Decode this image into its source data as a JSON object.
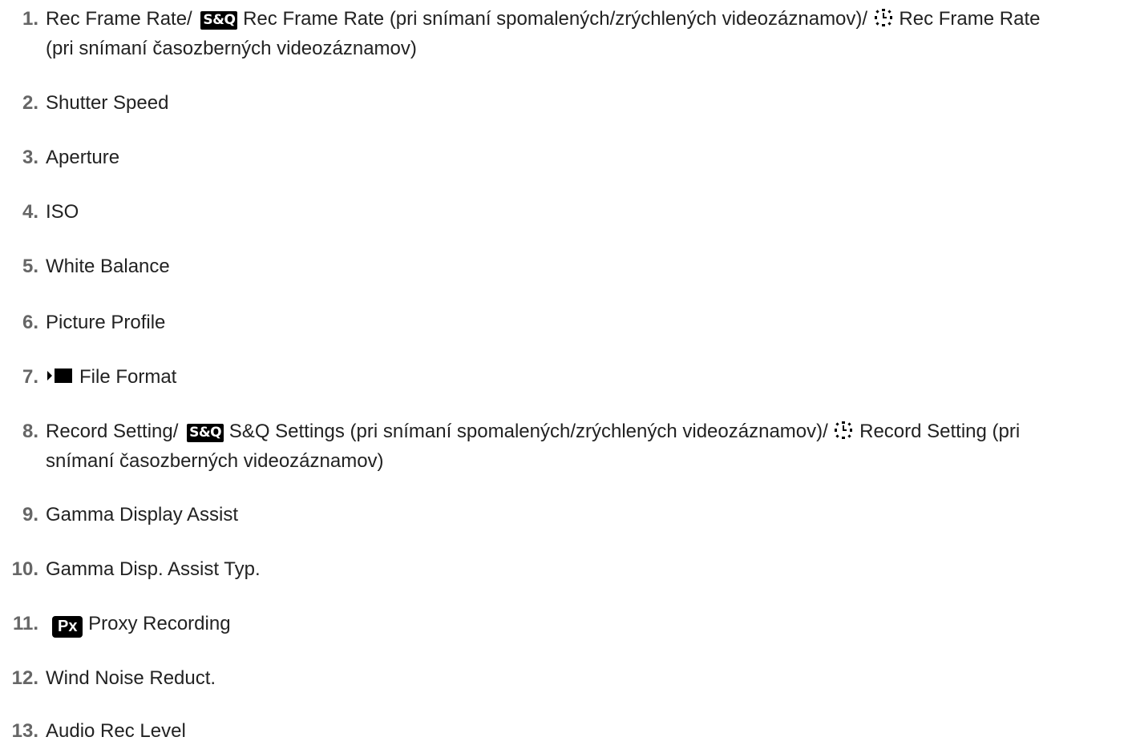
{
  "items": [
    {
      "num": "1.",
      "t1": "Rec Frame Rate/ ",
      "icon1": "S&Q",
      "t2": "Rec Frame Rate (pri snímaní spomalených/zrýchlených videozáznamov)/ ",
      "icon2": "time-lapse-icon",
      "t3": "Rec Frame Rate",
      "t4": "(pri snímaní časozberných videozáznamov)"
    },
    {
      "num": "2.",
      "text": "Shutter Speed"
    },
    {
      "num": "3.",
      "text": "Aperture"
    },
    {
      "num": "4.",
      "text": "ISO"
    },
    {
      "num": "5.",
      "text": "White Balance"
    },
    {
      "num": "6.",
      "text": "Picture Profile"
    },
    {
      "num": "7.",
      "icon": "movie-icon",
      "text": "File Format"
    },
    {
      "num": "8.",
      "t1": "Record Setting/ ",
      "icon1": "S&Q",
      "t2": "S&Q Settings (pri snímaní spomalených/zrýchlených videozáznamov)/ ",
      "icon2": "time-lapse-icon",
      "t3": "Record Setting (pri",
      "t4": "snímaní časozberných videozáznamov)"
    },
    {
      "num": "9.",
      "text": "Gamma Display Assist"
    },
    {
      "num": "10.",
      "text": "Gamma Disp. Assist Typ."
    },
    {
      "num": "11.",
      "icon": "Px",
      "text": "Proxy Recording"
    },
    {
      "num": "12.",
      "text": "Wind Noise Reduct."
    },
    {
      "num": "13.",
      "text": "Audio Rec Level"
    }
  ]
}
